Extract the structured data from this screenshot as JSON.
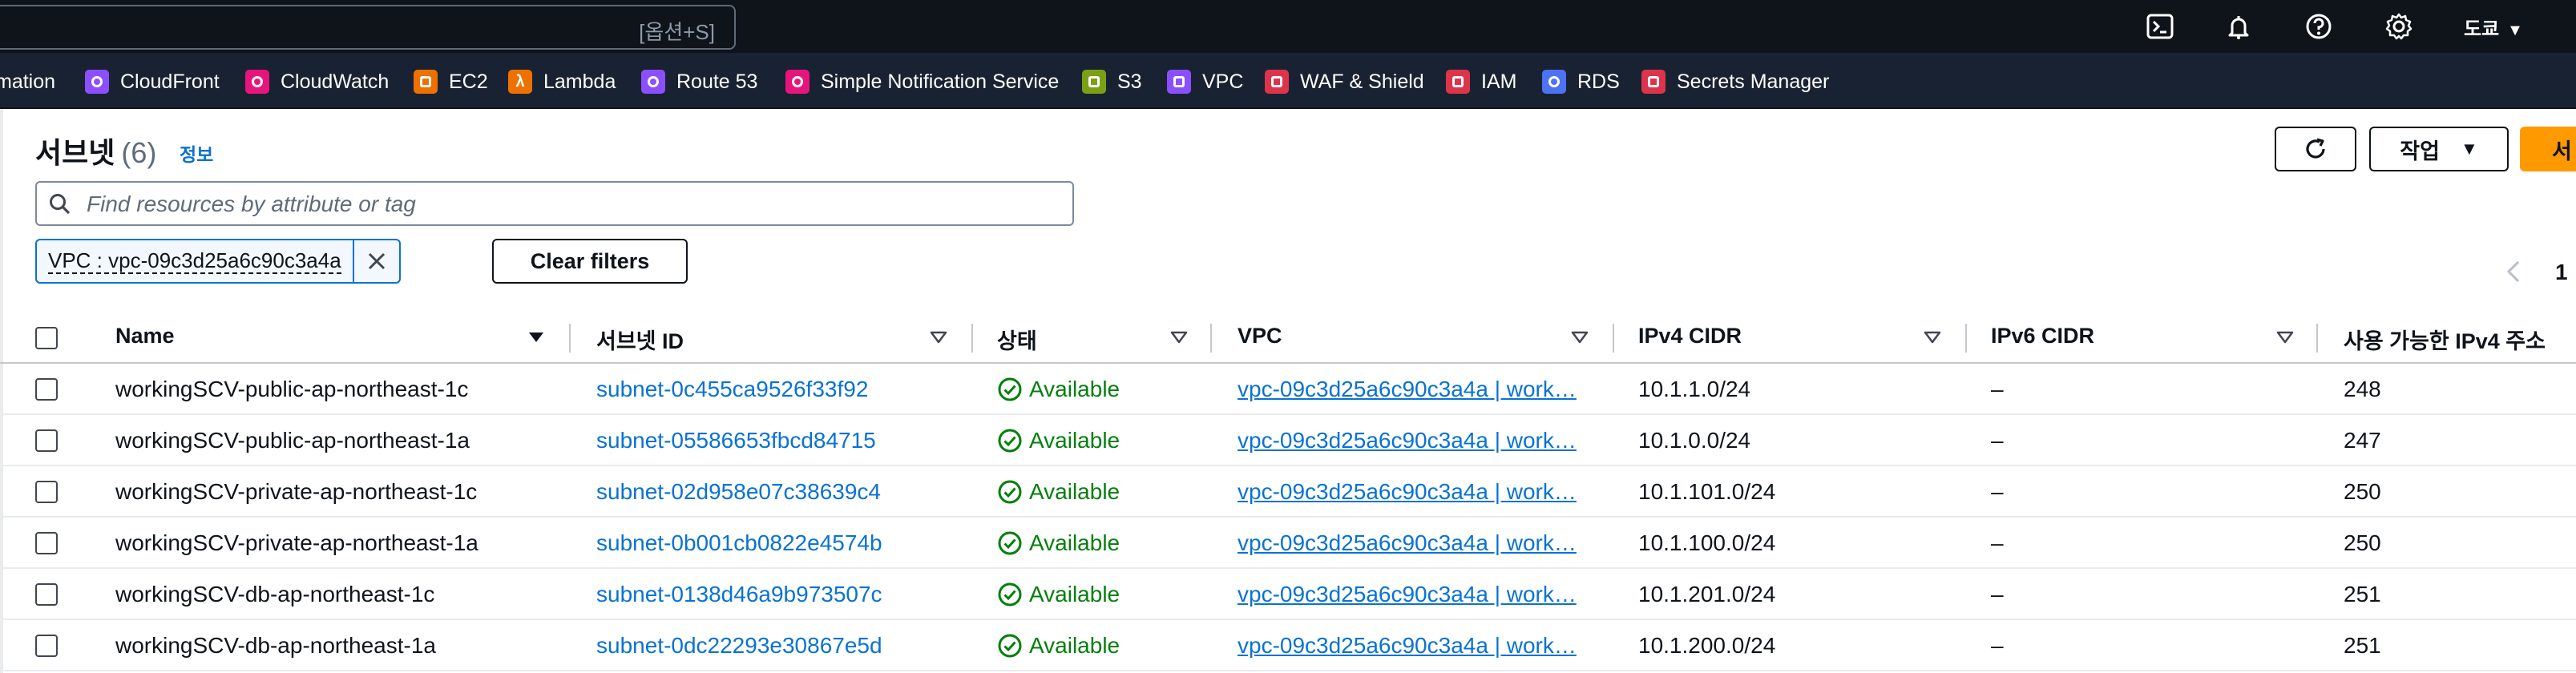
{
  "topbar": {
    "search_hint": "[옵션+S]",
    "region": "도쿄",
    "icons": [
      "cloudshell-icon",
      "notifications-bell-icon",
      "help-icon",
      "settings-gear-icon"
    ]
  },
  "favorites": [
    {
      "label": "mation",
      "color": ""
    },
    {
      "label": "CloudFront",
      "color": "#8c4fff"
    },
    {
      "label": "CloudWatch",
      "color": "#e7157b"
    },
    {
      "label": "EC2",
      "color": "#ed7100"
    },
    {
      "label": "Lambda",
      "color": "#ed7100"
    },
    {
      "label": "Route 53",
      "color": "#8c4fff"
    },
    {
      "label": "Simple Notification Service",
      "color": "#e7157b"
    },
    {
      "label": "S3",
      "color": "#7aa116"
    },
    {
      "label": "VPC",
      "color": "#8c4fff"
    },
    {
      "label": "WAF & Shield",
      "color": "#dd344c"
    },
    {
      "label": "IAM",
      "color": "#dd344c"
    },
    {
      "label": "RDS",
      "color": "#4d72f3"
    },
    {
      "label": "Secrets Manager",
      "color": "#dd344c"
    }
  ],
  "header": {
    "title": "서브넷",
    "count": "(6)",
    "info": "정보",
    "actions_label": "작업",
    "create_label": "서"
  },
  "filter": {
    "placeholder": "Find resources by attribute or tag",
    "token": "VPC : vpc-09c3d25a6c90c3a4a",
    "clear_label": "Clear filters"
  },
  "pagination": {
    "current_page": "1"
  },
  "table": {
    "columns": {
      "name": "Name",
      "subnet_id": "서브넷 ID",
      "state": "상태",
      "vpc": "VPC",
      "ipv4": "IPv4 CIDR",
      "ipv6": "IPv6 CIDR",
      "available_ips": "사용 가능한 IPv4 주소"
    },
    "rows": [
      {
        "name": "workingSCV-public-ap-northeast-1c",
        "subnet_id": "subnet-0c455ca9526f33f92",
        "state": "Available",
        "vpc": "vpc-09c3d25a6c90c3a4a | work…",
        "ipv4": "10.1.1.0/24",
        "ipv6": "–",
        "available_ips": "248"
      },
      {
        "name": "workingSCV-public-ap-northeast-1a",
        "subnet_id": "subnet-05586653fbcd84715",
        "state": "Available",
        "vpc": "vpc-09c3d25a6c90c3a4a | work…",
        "ipv4": "10.1.0.0/24",
        "ipv6": "–",
        "available_ips": "247"
      },
      {
        "name": "workingSCV-private-ap-northeast-1c",
        "subnet_id": "subnet-02d958e07c38639c4",
        "state": "Available",
        "vpc": "vpc-09c3d25a6c90c3a4a | work…",
        "ipv4": "10.1.101.0/24",
        "ipv6": "–",
        "available_ips": "250"
      },
      {
        "name": "workingSCV-private-ap-northeast-1a",
        "subnet_id": "subnet-0b001cb0822e4574b",
        "state": "Available",
        "vpc": "vpc-09c3d25a6c90c3a4a | work…",
        "ipv4": "10.1.100.0/24",
        "ipv6": "–",
        "available_ips": "250"
      },
      {
        "name": "workingSCV-db-ap-northeast-1c",
        "subnet_id": "subnet-0138d46a9b973507c",
        "state": "Available",
        "vpc": "vpc-09c3d25a6c90c3a4a | work…",
        "ipv4": "10.1.201.0/24",
        "ipv6": "–",
        "available_ips": "251"
      },
      {
        "name": "workingSCV-db-ap-northeast-1a",
        "subnet_id": "subnet-0dc22293e30867e5d",
        "state": "Available",
        "vpc": "vpc-09c3d25a6c90c3a4a | work…",
        "ipv4": "10.1.200.0/24",
        "ipv6": "–",
        "available_ips": "251"
      }
    ]
  }
}
